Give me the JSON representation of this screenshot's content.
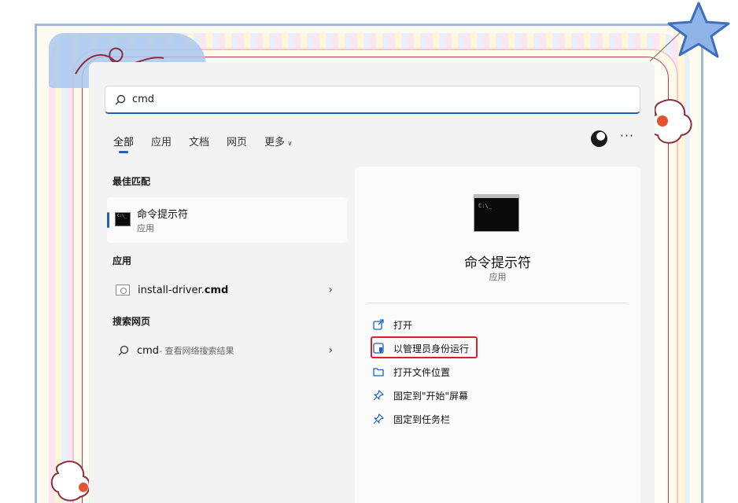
{
  "search": {
    "query": "cmd"
  },
  "tabs": [
    {
      "label": "全部"
    },
    {
      "label": "应用"
    },
    {
      "label": "文档"
    },
    {
      "label": "网页"
    },
    {
      "label": "更多"
    }
  ],
  "header": {
    "more_glyph": "···"
  },
  "best_match": {
    "heading": "最佳匹配",
    "title": "命令提示符",
    "subtitle": "应用"
  },
  "apps": {
    "heading": "应用",
    "item_prefix": "install-driver.",
    "item_bold": "cmd"
  },
  "web": {
    "heading": "搜索网页",
    "query": "cmd",
    "suffix": " - 查看网络搜索结果"
  },
  "detail": {
    "title": "命令提示符",
    "subtitle": "应用",
    "actions": [
      {
        "label": "打开"
      },
      {
        "label": "以管理员身份运行"
      },
      {
        "label": "打开文件位置"
      },
      {
        "label": "固定到\"开始\"屏幕"
      },
      {
        "label": "固定到任务栏"
      }
    ]
  },
  "colors": {
    "accent": "#1f5fb5",
    "highlight_border": "#d6252a"
  }
}
